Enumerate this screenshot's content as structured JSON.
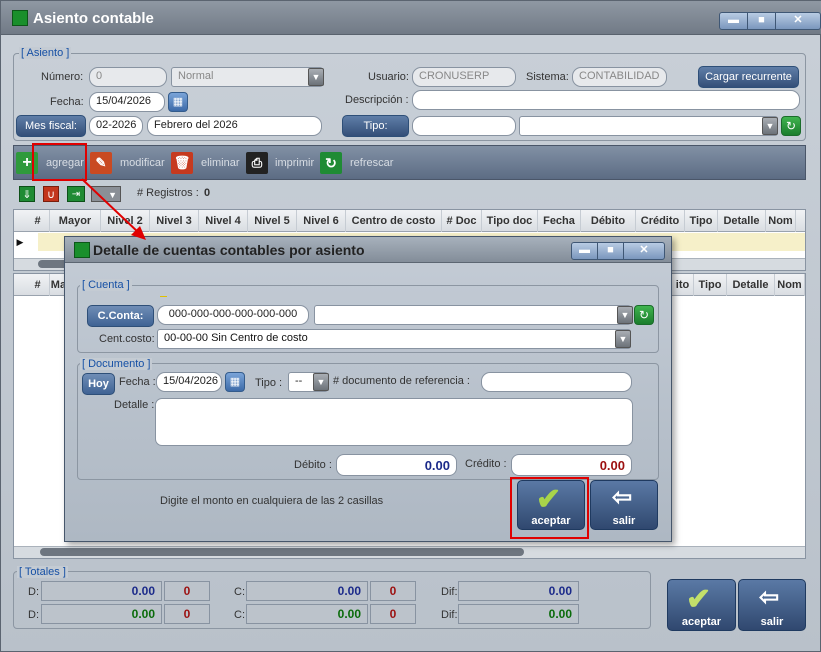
{
  "window": {
    "title": "Asiento contable",
    "min_label": "▬",
    "max_label": "■",
    "close_label": "✕"
  },
  "asiento": {
    "group_label": "[ Asiento ]",
    "numero_label": "Número:",
    "numero_value": "0",
    "estado_value": "Normal",
    "usuario_label": "Usuario:",
    "usuario_value": "CRONUSERP",
    "sistema_label": "Sistema:",
    "sistema_value": "CONTABILIDAD",
    "cargar_label": "Cargar recurrente",
    "fecha_label": "Fecha:",
    "fecha_value": "15/04/2026",
    "descripcion_label": "Descripción :",
    "descripcion_value": "",
    "mes_fiscal_label": "Mes fiscal:",
    "mes_value": "02-2026",
    "mes_nombre": "Febrero del 2026",
    "tipo_label": "Tipo:",
    "tipo_value": "",
    "tipo_select": ""
  },
  "toolbar": {
    "agregar": "agregar",
    "modificar": "modificar",
    "eliminar": "eliminar",
    "imprimir": "imprimir",
    "refrescar": "refrescar"
  },
  "subtoolbar": {
    "registros_label": "# Registros :",
    "registros_count": "0"
  },
  "grid1": {
    "columns": [
      "#",
      "Mayor",
      "Nivel 2",
      "Nivel 3",
      "Nivel 4",
      "Nivel 5",
      "Nivel 6",
      "Centro de costo",
      "# Doc",
      "Tipo doc",
      "Fecha",
      "Débito",
      "Crédito",
      "Tipo",
      "Detalle",
      "Nom"
    ]
  },
  "grid2": {
    "columns_left": [
      "#",
      "May"
    ],
    "columns_right": [
      "ito",
      "Tipo",
      "Detalle",
      "Nom"
    ]
  },
  "dialog": {
    "title": "Detalle de cuentas contables por asiento",
    "cuenta_group": "[ Cuenta ]",
    "cconta_label": "C.Conta:",
    "cconta_value": "000-000-000-000-000-000",
    "cconta_desc": "",
    "centcosto_label": "Cent.costo:",
    "centcosto_value": "00-00-00 Sin Centro de costo",
    "documento_group": "[ Documento ]",
    "hoy_label": "Hoy",
    "fecha_label": "Fecha :",
    "fecha_value": "15/04/2026",
    "tipo_label": "Tipo :",
    "tipo_value": "--",
    "docref_label": "# documento de referencia :",
    "docref_value": "",
    "detalle_label": "Detalle :",
    "detalle_value": "",
    "debito_label": "Débito :",
    "debito_value": "0.00",
    "credito_label": "Crédito :",
    "credito_value": "0.00",
    "hint": "Digite el monto en cualquiera de las 2 casillas",
    "aceptar_label": "aceptar",
    "salir_label": "salir"
  },
  "totales": {
    "group_label": "[ Totales ]",
    "d_label": "D:",
    "c_label": "C:",
    "dif_label": "Dif:",
    "row1": {
      "d": "0.00",
      "d_count": "0",
      "c": "0.00",
      "c_count": "0",
      "dif": "0.00"
    },
    "row2": {
      "d": "0.00",
      "d_count": "0",
      "c": "0.00",
      "c_count": "0",
      "dif": "0.00"
    }
  },
  "footer": {
    "aceptar_label": "aceptar",
    "salir_label": "salir"
  },
  "colors": {
    "accent_blue": "#1650a5",
    "green": "#1a8f2c",
    "debit_blue": "#1b2a8a",
    "credit_red": "#9c1010",
    "dark_green": "#0a6b0a",
    "highlight_red": "#e00000"
  }
}
